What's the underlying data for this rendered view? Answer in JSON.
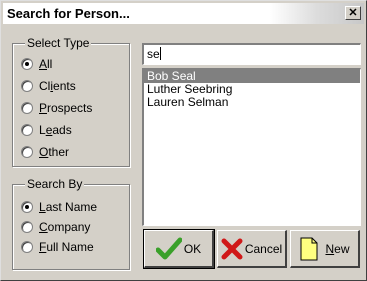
{
  "window": {
    "title": "Search for Person..."
  },
  "select_type": {
    "legend": "Select Type",
    "options": [
      {
        "label": "All",
        "key": "A",
        "selected": true
      },
      {
        "label": "Clients",
        "key": "i",
        "selected": false
      },
      {
        "label": "Prospects",
        "key": "P",
        "selected": false
      },
      {
        "label": "Leads",
        "key": "e",
        "selected": false
      },
      {
        "label": "Other",
        "key": "O",
        "selected": false
      }
    ]
  },
  "search_by": {
    "legend": "Search By",
    "options": [
      {
        "label": "Last Name",
        "key": "L",
        "selected": true
      },
      {
        "label": "Company",
        "key": "C",
        "selected": false
      },
      {
        "label": "Full Name",
        "key": "F",
        "selected": false
      }
    ]
  },
  "search": {
    "value": "se"
  },
  "results": [
    {
      "name": "Bob Seal",
      "selected": true
    },
    {
      "name": "Luther Seebring",
      "selected": false
    },
    {
      "name": "Lauren Selman",
      "selected": false
    }
  ],
  "buttons": {
    "ok": "OK",
    "cancel": "Cancel",
    "new": "New"
  },
  "colors": {
    "face": "#d4d0c8",
    "selection": "#808080",
    "ok_check": "#3aa02a",
    "cancel_x": "#d01818",
    "new_page": "#ffff80"
  }
}
